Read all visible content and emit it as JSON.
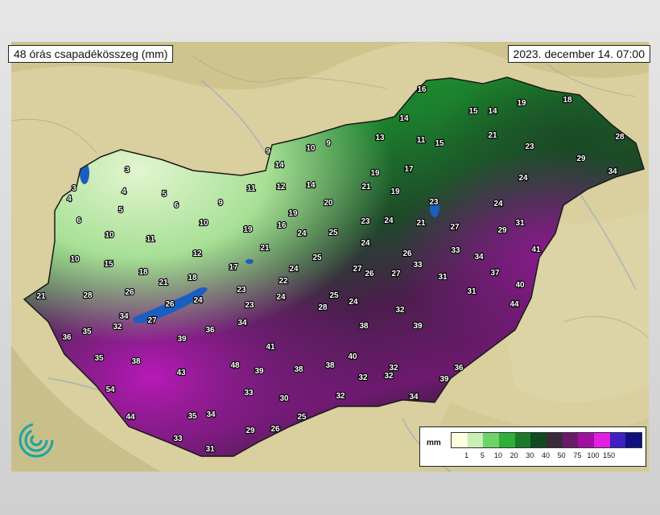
{
  "title": "48 órás csapadékösszeg (mm)",
  "date": "2023. december 14. 07:00",
  "legend": {
    "unit": "mm",
    "ticks": [
      "1",
      "5",
      "10",
      "20",
      "30",
      "40",
      "50",
      "75",
      "100",
      "150"
    ],
    "colors": [
      "#ffffe0",
      "#c8f0b4",
      "#6fd36a",
      "#2fae3a",
      "#1a7a2a",
      "#0f4a20",
      "#3a2a3a",
      "#6a1a6a",
      "#a010a0",
      "#e020e0",
      "#4020c0",
      "#101080"
    ]
  },
  "stations": [
    [
      524,
      110,
      "16"
    ],
    [
      588,
      137,
      "15"
    ],
    [
      612,
      137,
      "14"
    ],
    [
      648,
      127,
      "19"
    ],
    [
      705,
      123,
      "18"
    ],
    [
      502,
      146,
      "14"
    ],
    [
      472,
      170,
      "13"
    ],
    [
      523,
      173,
      "11"
    ],
    [
      546,
      177,
      "15"
    ],
    [
      612,
      167,
      "21"
    ],
    [
      658,
      181,
      "23"
    ],
    [
      770,
      169,
      "28"
    ],
    [
      333,
      187,
      "9"
    ],
    [
      386,
      183,
      "10"
    ],
    [
      408,
      177,
      "9"
    ],
    [
      347,
      204,
      "14"
    ],
    [
      466,
      214,
      "19"
    ],
    [
      508,
      209,
      "17"
    ],
    [
      722,
      196,
      "29"
    ],
    [
      761,
      212,
      "34"
    ],
    [
      312,
      233,
      "11"
    ],
    [
      349,
      231,
      "12"
    ],
    [
      386,
      229,
      "14"
    ],
    [
      455,
      231,
      "21"
    ],
    [
      491,
      237,
      "19"
    ],
    [
      650,
      220,
      "24"
    ],
    [
      274,
      251,
      "9"
    ],
    [
      408,
      251,
      "20"
    ],
    [
      539,
      250,
      "23"
    ],
    [
      619,
      252,
      "24"
    ],
    [
      364,
      264,
      "19"
    ],
    [
      253,
      276,
      "10"
    ],
    [
      350,
      279,
      "16"
    ],
    [
      454,
      274,
      "23"
    ],
    [
      483,
      273,
      "24"
    ],
    [
      523,
      276,
      "21"
    ],
    [
      565,
      281,
      "27"
    ],
    [
      646,
      276,
      "31"
    ],
    [
      308,
      284,
      "19"
    ],
    [
      375,
      289,
      "24"
    ],
    [
      414,
      288,
      "25"
    ],
    [
      624,
      285,
      "29"
    ],
    [
      187,
      296,
      "11"
    ],
    [
      454,
      301,
      "24"
    ],
    [
      329,
      307,
      "21"
    ],
    [
      506,
      314,
      "26"
    ],
    [
      566,
      310,
      "33"
    ],
    [
      595,
      318,
      "34"
    ],
    [
      666,
      309,
      "41"
    ],
    [
      245,
      314,
      "12"
    ],
    [
      394,
      319,
      "25"
    ],
    [
      290,
      331,
      "17"
    ],
    [
      365,
      333,
      "24"
    ],
    [
      519,
      328,
      "33"
    ],
    [
      444,
      333,
      "27"
    ],
    [
      459,
      339,
      "26"
    ],
    [
      492,
      339,
      "27"
    ],
    [
      615,
      338,
      "37"
    ],
    [
      178,
      337,
      "18"
    ],
    [
      352,
      348,
      "22"
    ],
    [
      550,
      343,
      "31"
    ],
    [
      646,
      353,
      "40"
    ],
    [
      239,
      344,
      "18"
    ],
    [
      203,
      350,
      "21"
    ],
    [
      300,
      359,
      "23"
    ],
    [
      161,
      362,
      "26"
    ],
    [
      586,
      361,
      "31"
    ],
    [
      349,
      368,
      "24"
    ],
    [
      415,
      366,
      "25"
    ],
    [
      439,
      374,
      "24"
    ],
    [
      246,
      372,
      "24"
    ],
    [
      211,
      377,
      "26"
    ],
    [
      639,
      377,
      "44"
    ],
    [
      310,
      378,
      "23"
    ],
    [
      401,
      381,
      "28"
    ],
    [
      497,
      384,
      "32"
    ],
    [
      154,
      392,
      "34"
    ],
    [
      189,
      397,
      "27"
    ],
    [
      301,
      400,
      "34"
    ],
    [
      146,
      405,
      "32"
    ],
    [
      452,
      404,
      "38"
    ],
    [
      519,
      404,
      "39"
    ],
    [
      108,
      411,
      "35"
    ],
    [
      83,
      418,
      "36"
    ],
    [
      261,
      409,
      "36"
    ],
    [
      226,
      420,
      "39"
    ],
    [
      336,
      430,
      "41"
    ],
    [
      123,
      444,
      "35"
    ],
    [
      438,
      442,
      "40"
    ],
    [
      169,
      448,
      "38"
    ],
    [
      292,
      453,
      "48"
    ],
    [
      322,
      460,
      "39"
    ],
    [
      371,
      458,
      "38"
    ],
    [
      410,
      453,
      "38"
    ],
    [
      489,
      456,
      "32"
    ],
    [
      570,
      456,
      "36"
    ],
    [
      225,
      462,
      "43"
    ],
    [
      451,
      468,
      "32"
    ],
    [
      483,
      466,
      "32"
    ],
    [
      552,
      470,
      "39"
    ],
    [
      137,
      483,
      "54"
    ],
    [
      309,
      487,
      "33"
    ],
    [
      353,
      494,
      "30"
    ],
    [
      423,
      491,
      "32"
    ],
    [
      514,
      492,
      "34"
    ],
    [
      162,
      517,
      "44"
    ],
    [
      262,
      514,
      "34"
    ],
    [
      239,
      516,
      "35"
    ],
    [
      375,
      517,
      "25"
    ],
    [
      311,
      534,
      "29"
    ],
    [
      342,
      532,
      "26"
    ],
    [
      221,
      544,
      "33"
    ],
    [
      261,
      557,
      "31"
    ],
    [
      158,
      210,
      "3"
    ],
    [
      154,
      237,
      "4"
    ],
    [
      204,
      240,
      "5"
    ],
    [
      92,
      233,
      "3"
    ],
    [
      86,
      246,
      "4"
    ],
    [
      150,
      260,
      "5"
    ],
    [
      219,
      254,
      "6"
    ],
    [
      98,
      273,
      "6"
    ],
    [
      136,
      291,
      "10"
    ],
    [
      93,
      321,
      "10"
    ],
    [
      135,
      327,
      "15"
    ],
    [
      109,
      366,
      "28"
    ],
    [
      51,
      367,
      "21"
    ]
  ]
}
